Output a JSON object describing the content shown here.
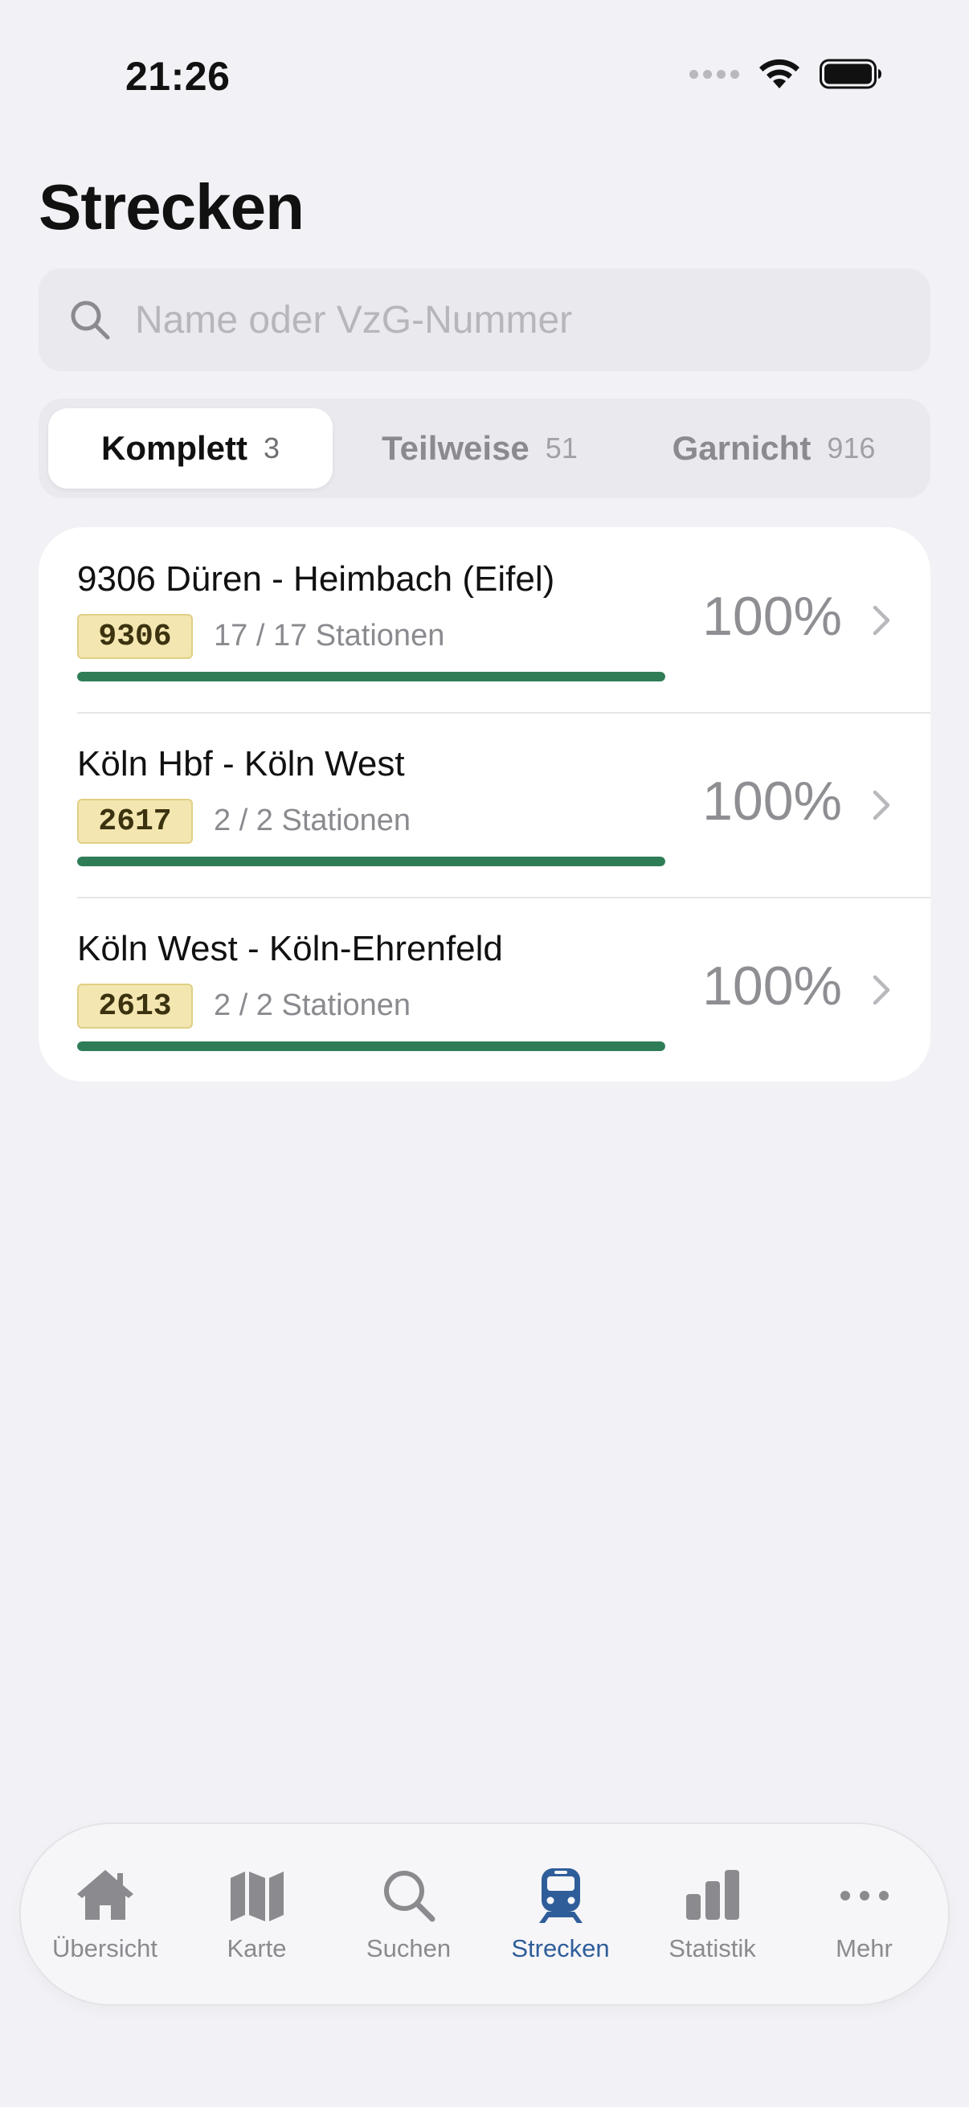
{
  "status": {
    "time": "21:26"
  },
  "header": {
    "title": "Strecken"
  },
  "search": {
    "placeholder": "Name oder VzG-Nummer"
  },
  "segments": [
    {
      "label": "Komplett",
      "count": "3"
    },
    {
      "label": "Teilweise",
      "count": "51"
    },
    {
      "label": "Garnicht",
      "count": "916"
    }
  ],
  "routes": [
    {
      "title": "9306 Düren - Heimbach (Eifel)",
      "number": "9306",
      "stations": "17 / 17 Stationen",
      "percent": "100%",
      "progress": 1.0
    },
    {
      "title": "Köln Hbf - Köln West",
      "number": "2617",
      "stations": "2 / 2 Stationen",
      "percent": "100%",
      "progress": 1.0
    },
    {
      "title": "Köln West - Köln-Ehrenfeld",
      "number": "2613",
      "stations": "2 / 2 Stationen",
      "percent": "100%",
      "progress": 1.0
    }
  ],
  "tabs": [
    {
      "label": "Übersicht",
      "icon": "house-icon"
    },
    {
      "label": "Karte",
      "icon": "map-icon"
    },
    {
      "label": "Suchen",
      "icon": "search-icon"
    },
    {
      "label": "Strecken",
      "icon": "train-icon"
    },
    {
      "label": "Statistik",
      "icon": "bar-chart-icon"
    },
    {
      "label": "Mehr",
      "icon": "ellipsis-icon"
    }
  ],
  "colors": {
    "accent": "#2f5d9a",
    "progress": "#2e7d57",
    "badge_bg": "#f3e6b0"
  }
}
